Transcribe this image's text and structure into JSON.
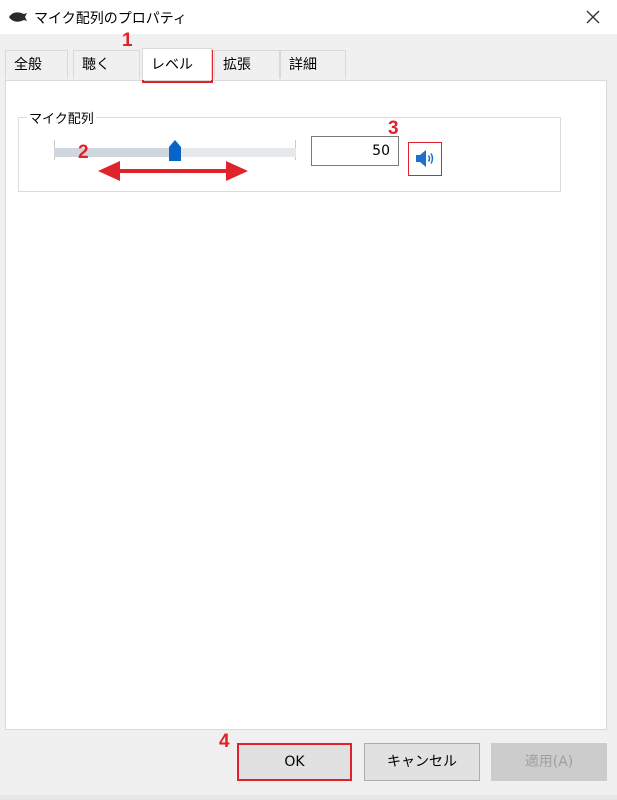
{
  "window": {
    "title": "マイク配列のプロパティ",
    "icon": "microphone-app-icon",
    "close_icon": "close-icon"
  },
  "tabs": [
    {
      "label": "全般",
      "active": false
    },
    {
      "label": "聴く",
      "active": false
    },
    {
      "label": "レベル",
      "active": true
    },
    {
      "label": "拡張",
      "active": false
    },
    {
      "label": "詳細",
      "active": false
    }
  ],
  "level": {
    "group_label": "マイク配列",
    "slider_value": 50,
    "slider_min": 0,
    "slider_max": 100,
    "value_text": "50",
    "speaker_icon": "speaker-icon"
  },
  "buttons": {
    "ok": "OK",
    "cancel": "キャンセル",
    "apply": "適用(A)"
  },
  "annotations": {
    "m1": "1",
    "m2": "2",
    "m3": "3",
    "m4": "4",
    "color": "#e0232a"
  }
}
